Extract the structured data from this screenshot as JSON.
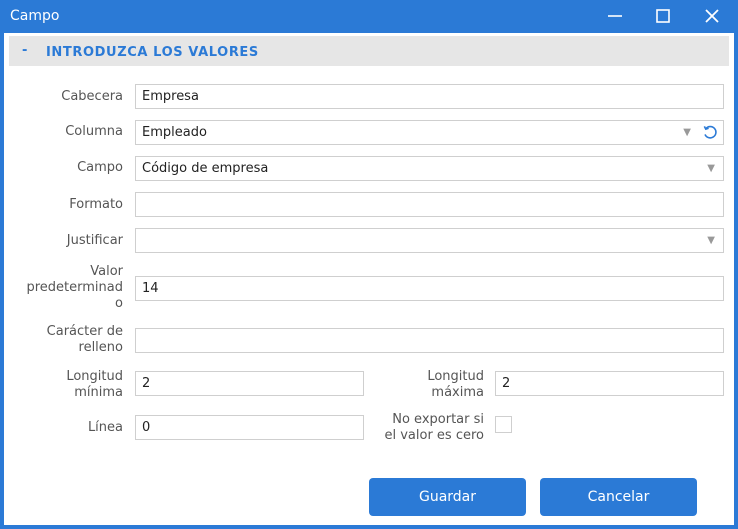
{
  "window": {
    "title": "Campo"
  },
  "section": {
    "toggle": "-",
    "title": "INTRODUZCA LOS VALORES"
  },
  "fields": {
    "cabecera": {
      "label": "Cabecera",
      "value": "Empresa"
    },
    "columna": {
      "label": "Columna",
      "value": "Empleado"
    },
    "campo": {
      "label": "Campo",
      "value": "Código de empresa"
    },
    "formato": {
      "label": "Formato",
      "value": ""
    },
    "justificar": {
      "label": "Justificar",
      "value": ""
    },
    "valor_predeterminado": {
      "label_lines": [
        "Valor",
        "predeterminad",
        "o"
      ],
      "value": "14"
    },
    "caracter_relleno": {
      "label_lines": [
        "Carácter de",
        "relleno"
      ],
      "value": ""
    },
    "longitud_minima": {
      "label_lines": [
        "Longitud",
        "mínima"
      ],
      "value": "2"
    },
    "longitud_maxima": {
      "label_lines": [
        "Longitud",
        "máxima"
      ],
      "value": "2"
    },
    "linea": {
      "label": "Línea",
      "value": "0"
    },
    "no_exportar": {
      "label_lines": [
        "No exportar si",
        "el valor es cero"
      ],
      "checked": false
    }
  },
  "buttons": {
    "save": "Guardar",
    "cancel": "Cancelar"
  },
  "colors": {
    "accent": "#2b7ad6",
    "section_bg": "#e6e6e6"
  }
}
